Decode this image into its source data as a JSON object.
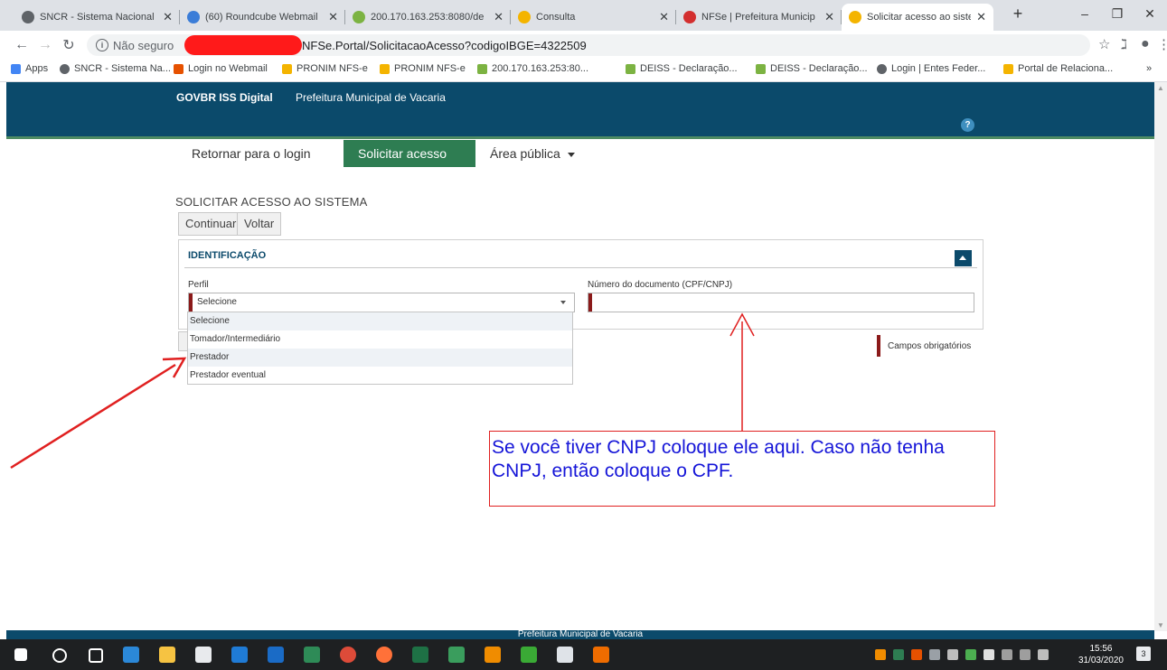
{
  "browser": {
    "tabs": [
      {
        "title": "SNCR - Sistema Nacional",
        "color": "#5f6368"
      },
      {
        "title": "(60) Roundcube Webmail",
        "color": "#3b7dd8"
      },
      {
        "title": "200.170.163.253:8080/de",
        "color": "#7cb342"
      },
      {
        "title": "Consulta",
        "color": "#f4b400"
      },
      {
        "title": "NFSe | Prefeitura Municip",
        "color": "#d32f2f"
      },
      {
        "title": "Solicitar acesso ao sistem",
        "color": "#f4b400"
      }
    ],
    "new_tab": "+",
    "window_controls": {
      "minimize": "–",
      "restore": "❐",
      "close": "✕"
    },
    "address": {
      "security_label": "Não seguro",
      "url_visible": "NFSe.Portal/SolicitacaoAcesso?codigoIBGE=4322509"
    },
    "bookmarks": [
      {
        "label": "Apps",
        "color": "#4285f4"
      },
      {
        "label": "SNCR - Sistema Na...",
        "color": "#5f6368"
      },
      {
        "label": "Login no Webmail",
        "color": "#e65100"
      },
      {
        "label": "PRONIM NFS-e",
        "color": "#f4b400"
      },
      {
        "label": "PRONIM NFS-e",
        "color": "#f4b400"
      },
      {
        "label": "200.170.163.253:80...",
        "color": "#7cb342"
      },
      {
        "label": "DEISS - Declaração...",
        "color": "#7cb342"
      },
      {
        "label": "DEISS - Declaração...",
        "color": "#7cb342"
      },
      {
        "label": "Login | Entes Feder...",
        "color": "#5f6368"
      },
      {
        "label": "Portal de Relaciona...",
        "color": "#f4b400"
      }
    ],
    "bookmarks_overflow": "»"
  },
  "site": {
    "brand": "GOVBR ISS Digital",
    "municipality": "Prefeitura Municipal de Vacaria",
    "help": "?"
  },
  "nav": {
    "return_login": "Retornar para o login",
    "request_access": "Solicitar acesso",
    "public_area": "Área pública"
  },
  "page": {
    "title": "SOLICITAR ACESSO AO SISTEMA",
    "continue_btn": "Continuar",
    "back_btn": "Voltar"
  },
  "form": {
    "section_title": "IDENTIFICAÇÃO",
    "profile_label": "Perfil",
    "profile_value": "Selecione",
    "document_label": "Número do documento (CPF/CNPJ)",
    "document_value": "",
    "profile_options": [
      "Selecione",
      "Tomador/Intermediário",
      "Prestador",
      "Prestador eventual"
    ],
    "required_legend": "Campos obrigatórios"
  },
  "annotation": {
    "callout_text": "Se você tiver CNPJ coloque ele aqui. Caso não tenha CNPJ, então coloque o CPF.",
    "color": "#e02020"
  },
  "footer": {
    "text": "Prefeitura Municipal de Vacaria"
  },
  "taskbar": {
    "time": "15:56",
    "date": "31/03/2020",
    "notifications": "3"
  }
}
